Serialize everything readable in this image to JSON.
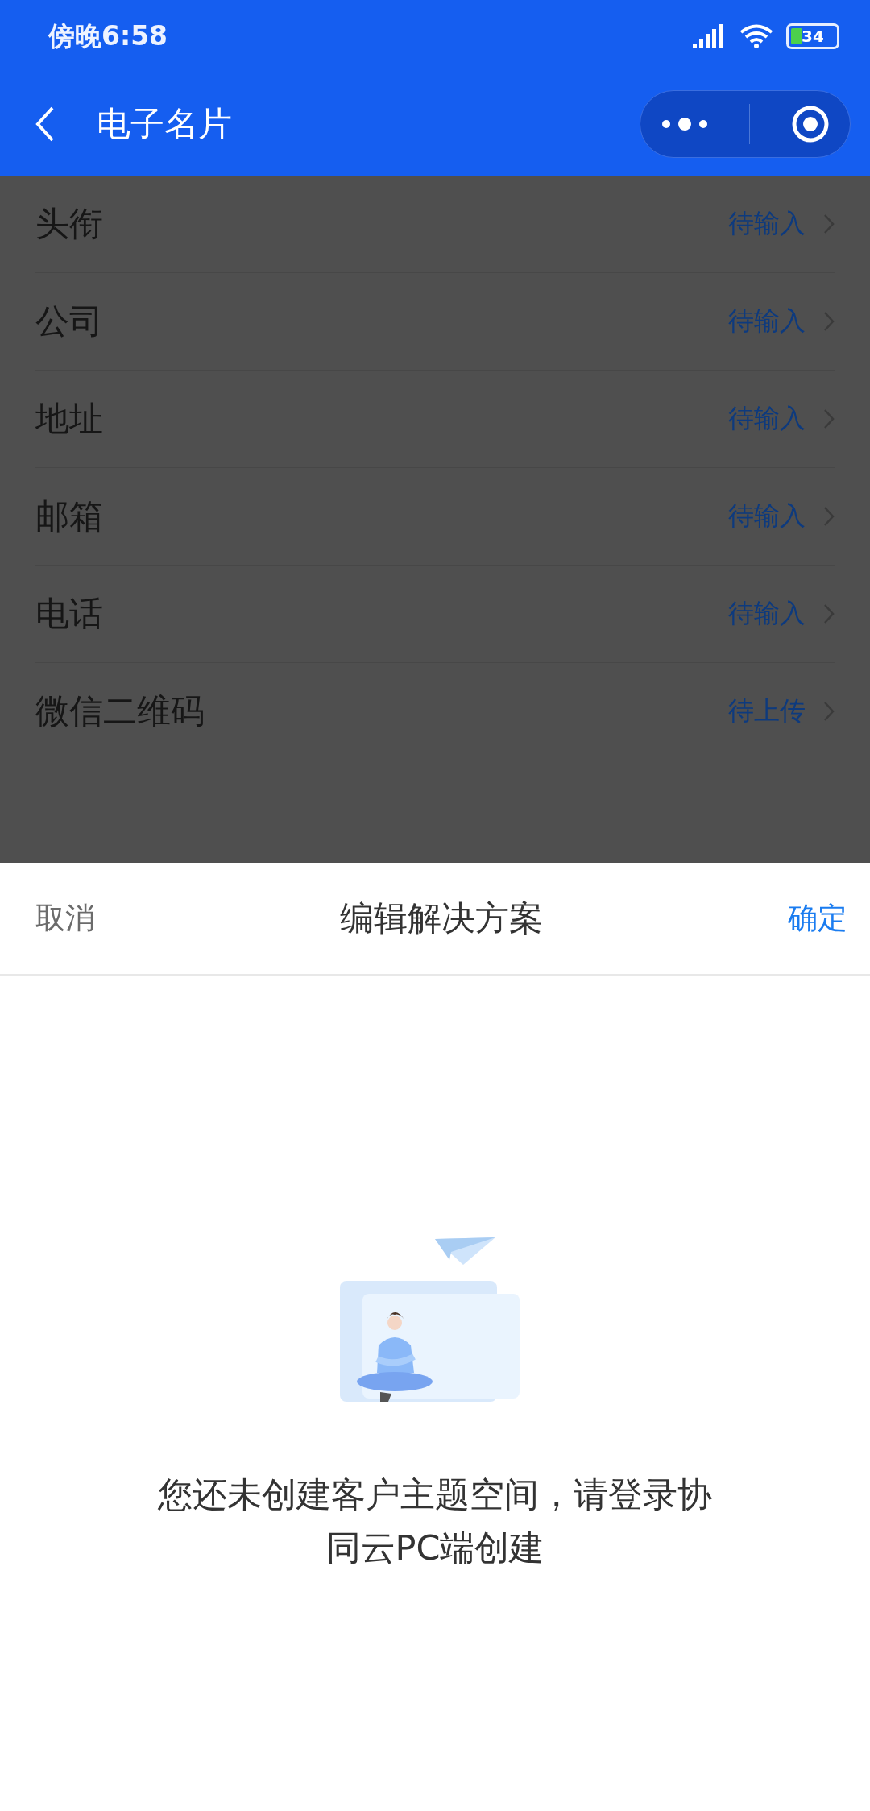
{
  "status_bar": {
    "time": "傍晚6:58",
    "battery": "34"
  },
  "nav": {
    "title": "电子名片"
  },
  "fields": [
    {
      "label": "头衔",
      "value": "待输入"
    },
    {
      "label": "公司",
      "value": "待输入"
    },
    {
      "label": "地址",
      "value": "待输入"
    },
    {
      "label": "邮箱",
      "value": "待输入"
    },
    {
      "label": "电话",
      "value": "待输入"
    },
    {
      "label": "微信二维码",
      "value": "待上传"
    }
  ],
  "sheet": {
    "cancel": "取消",
    "title": "编辑解决方案",
    "confirm": "确定",
    "message": "您还未创建客户主题空间，请登录协同云PC端创建"
  }
}
